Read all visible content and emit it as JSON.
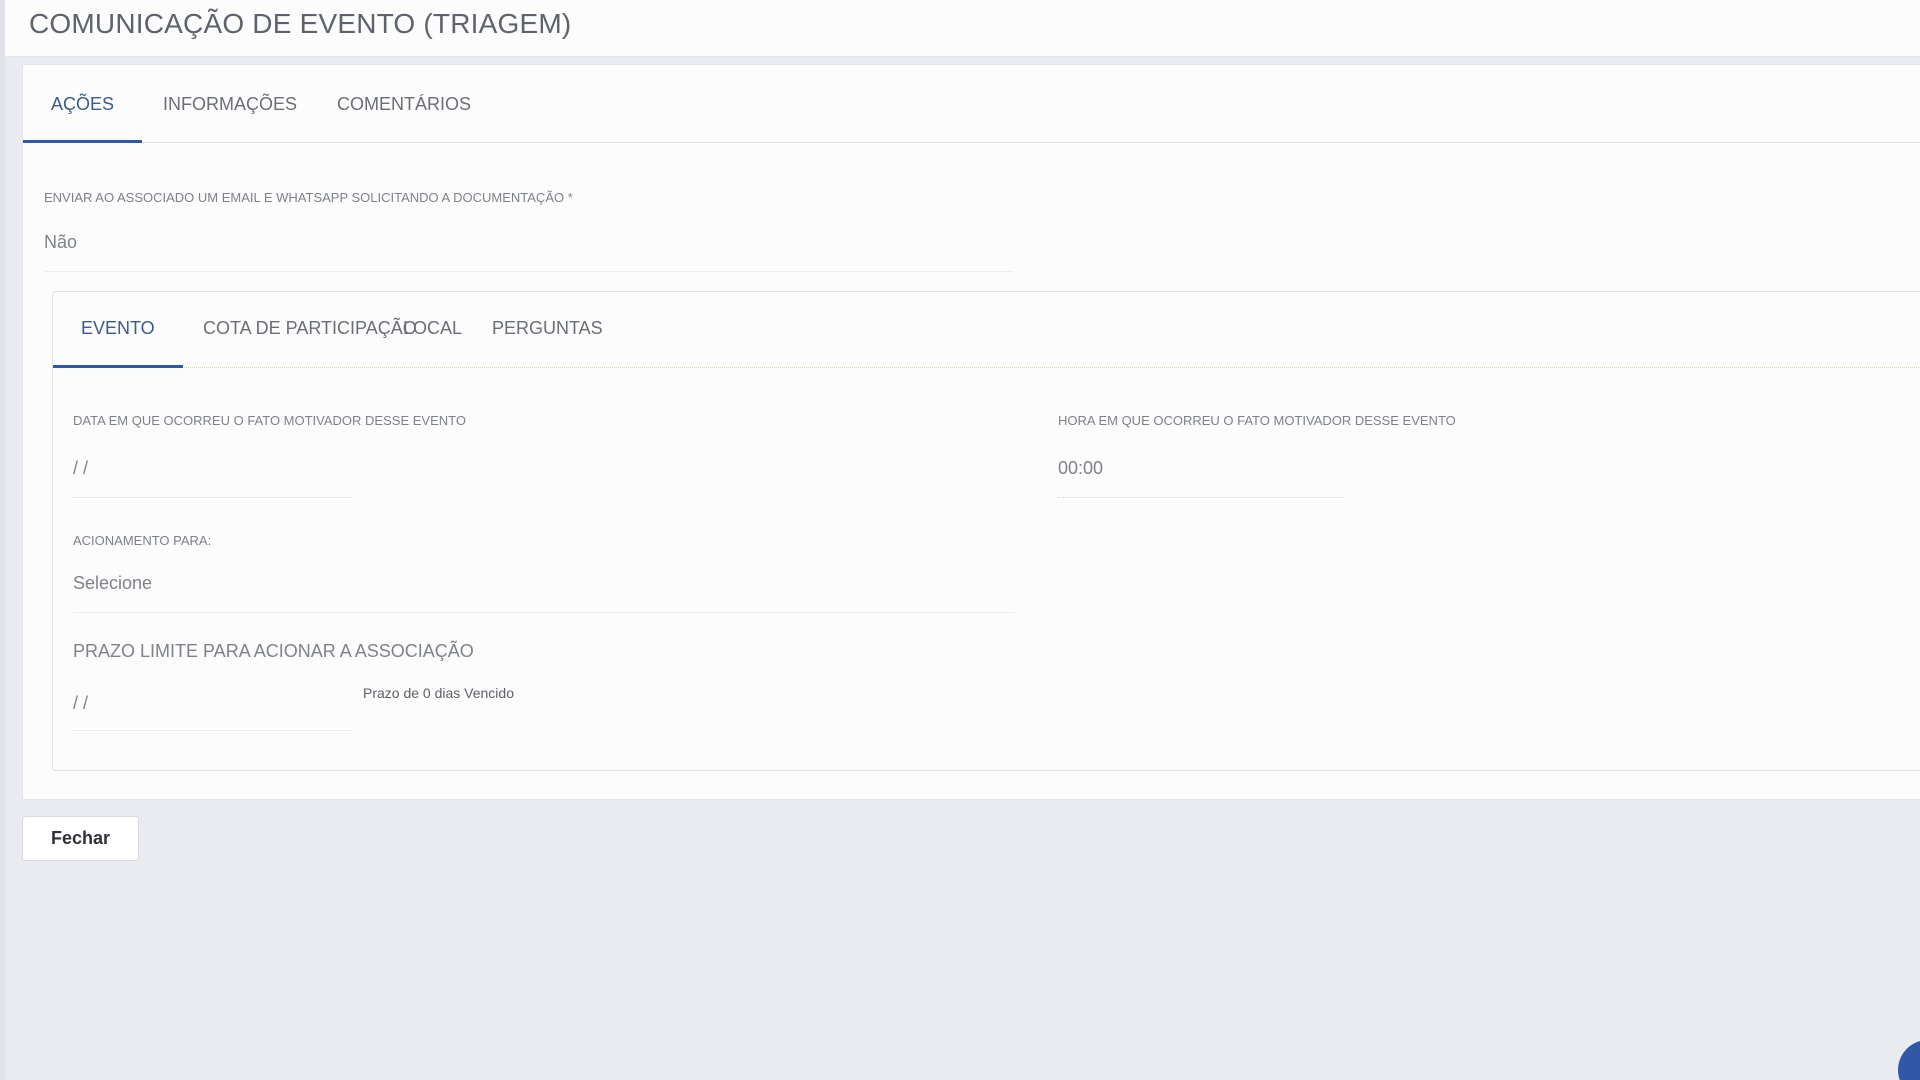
{
  "header": {
    "title": "COMUNICAÇÃO DE EVENTO (TRIAGEM)"
  },
  "tabs": [
    {
      "label": "AÇÕES",
      "active": true
    },
    {
      "label": "INFORMAÇÕES",
      "active": false
    },
    {
      "label": "COMENTÁRIOS",
      "active": false
    }
  ],
  "acoes": {
    "send_label": "ENVIAR AO ASSOCIADO UM EMAIL E WHATSAPP SOLICITANDO A DOCUMENTAÇÃO *",
    "send_value": "Não"
  },
  "inner_tabs": [
    {
      "label": "EVENTO",
      "active": true
    },
    {
      "label": "COTA DE PARTICIPAÇÃO",
      "active": false
    },
    {
      "label": "LOCAL",
      "active": false
    },
    {
      "label": "PERGUNTAS",
      "active": false
    }
  ],
  "evento": {
    "date_label": "DATA EM QUE OCORREU O FATO MOTIVADOR DESSE EVENTO",
    "date_value": "/ /",
    "time_label": "HORA EM QUE OCORREU O FATO MOTIVADOR DESSE EVENTO",
    "time_value": "00:00",
    "acionamento_label": "ACIONAMENTO PARA:",
    "acionamento_value": "Selecione",
    "prazo_label": "PRAZO LIMITE PARA ACIONAR A ASSOCIAÇÃO",
    "prazo_value": "/ /",
    "prazo_note": "Prazo de 0 dias Vencido"
  },
  "footer": {
    "close_label": "Fechar"
  },
  "colors": {
    "accent": "#2f59a8",
    "background": "#e9ebf0",
    "card": "#fcfcfc"
  }
}
